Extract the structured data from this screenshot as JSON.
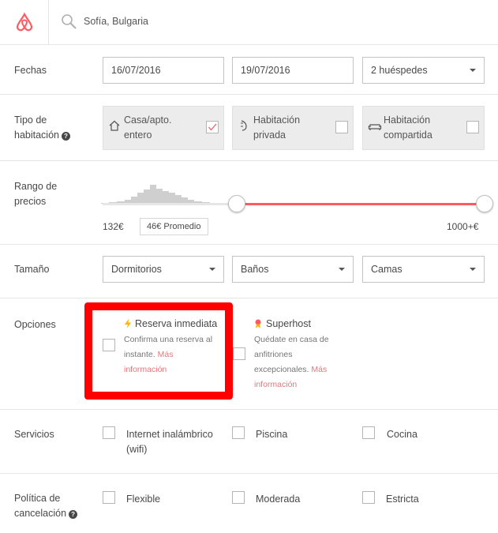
{
  "header": {
    "location": "Sofía, Bulgaria",
    "brand_color": "#ff5a5f"
  },
  "dates": {
    "label": "Fechas",
    "checkin": "16/07/2016",
    "checkout": "19/07/2016",
    "guests": "2 huéspedes"
  },
  "room_type": {
    "label_line1": "Tipo de",
    "label_line2": "habitación",
    "options": [
      {
        "line1": "Casa/apto.",
        "line2": "entero",
        "icon": "home-icon",
        "checked": true
      },
      {
        "line1": "Habitación",
        "line2": "privada",
        "icon": "door-icon",
        "checked": false
      },
      {
        "line1": "Habitación",
        "line2": "compartida",
        "icon": "couch-icon",
        "checked": false
      }
    ]
  },
  "price": {
    "label_line1": "Rango de",
    "label_line2": "precios",
    "min": "132€",
    "max": "1000+€",
    "average": "46€ Promedio",
    "range_fraction": [
      0.0,
      1.0
    ]
  },
  "size": {
    "label": "Tamaño",
    "bedrooms": "Dormitorios",
    "bathrooms": "Baños",
    "beds": "Camas"
  },
  "options": {
    "label": "Opciones",
    "instant": {
      "title": "Reserva inmediata",
      "desc1": "Confirma una reserva al",
      "desc2": "instante.",
      "more": "Más",
      "more2": "información",
      "icon": "lightning-icon"
    },
    "superhost": {
      "title": "Superhost",
      "desc1": "Quédate en casa de",
      "desc2": "anfitriones",
      "desc3": "excepcionales.",
      "more": "Más",
      "more2": "información",
      "icon": "superhost-badge-icon"
    }
  },
  "amenities": {
    "label": "Servicios",
    "items": [
      {
        "line1": "Internet inalámbrico",
        "line2": "(wifi)"
      },
      {
        "line1": "Piscina",
        "line2": ""
      },
      {
        "line1": "Cocina",
        "line2": ""
      }
    ]
  },
  "cancellation": {
    "label_line1": "Política de",
    "label_line2": "cancelación",
    "items": [
      "Flexible",
      "Moderada",
      "Estricta"
    ]
  }
}
